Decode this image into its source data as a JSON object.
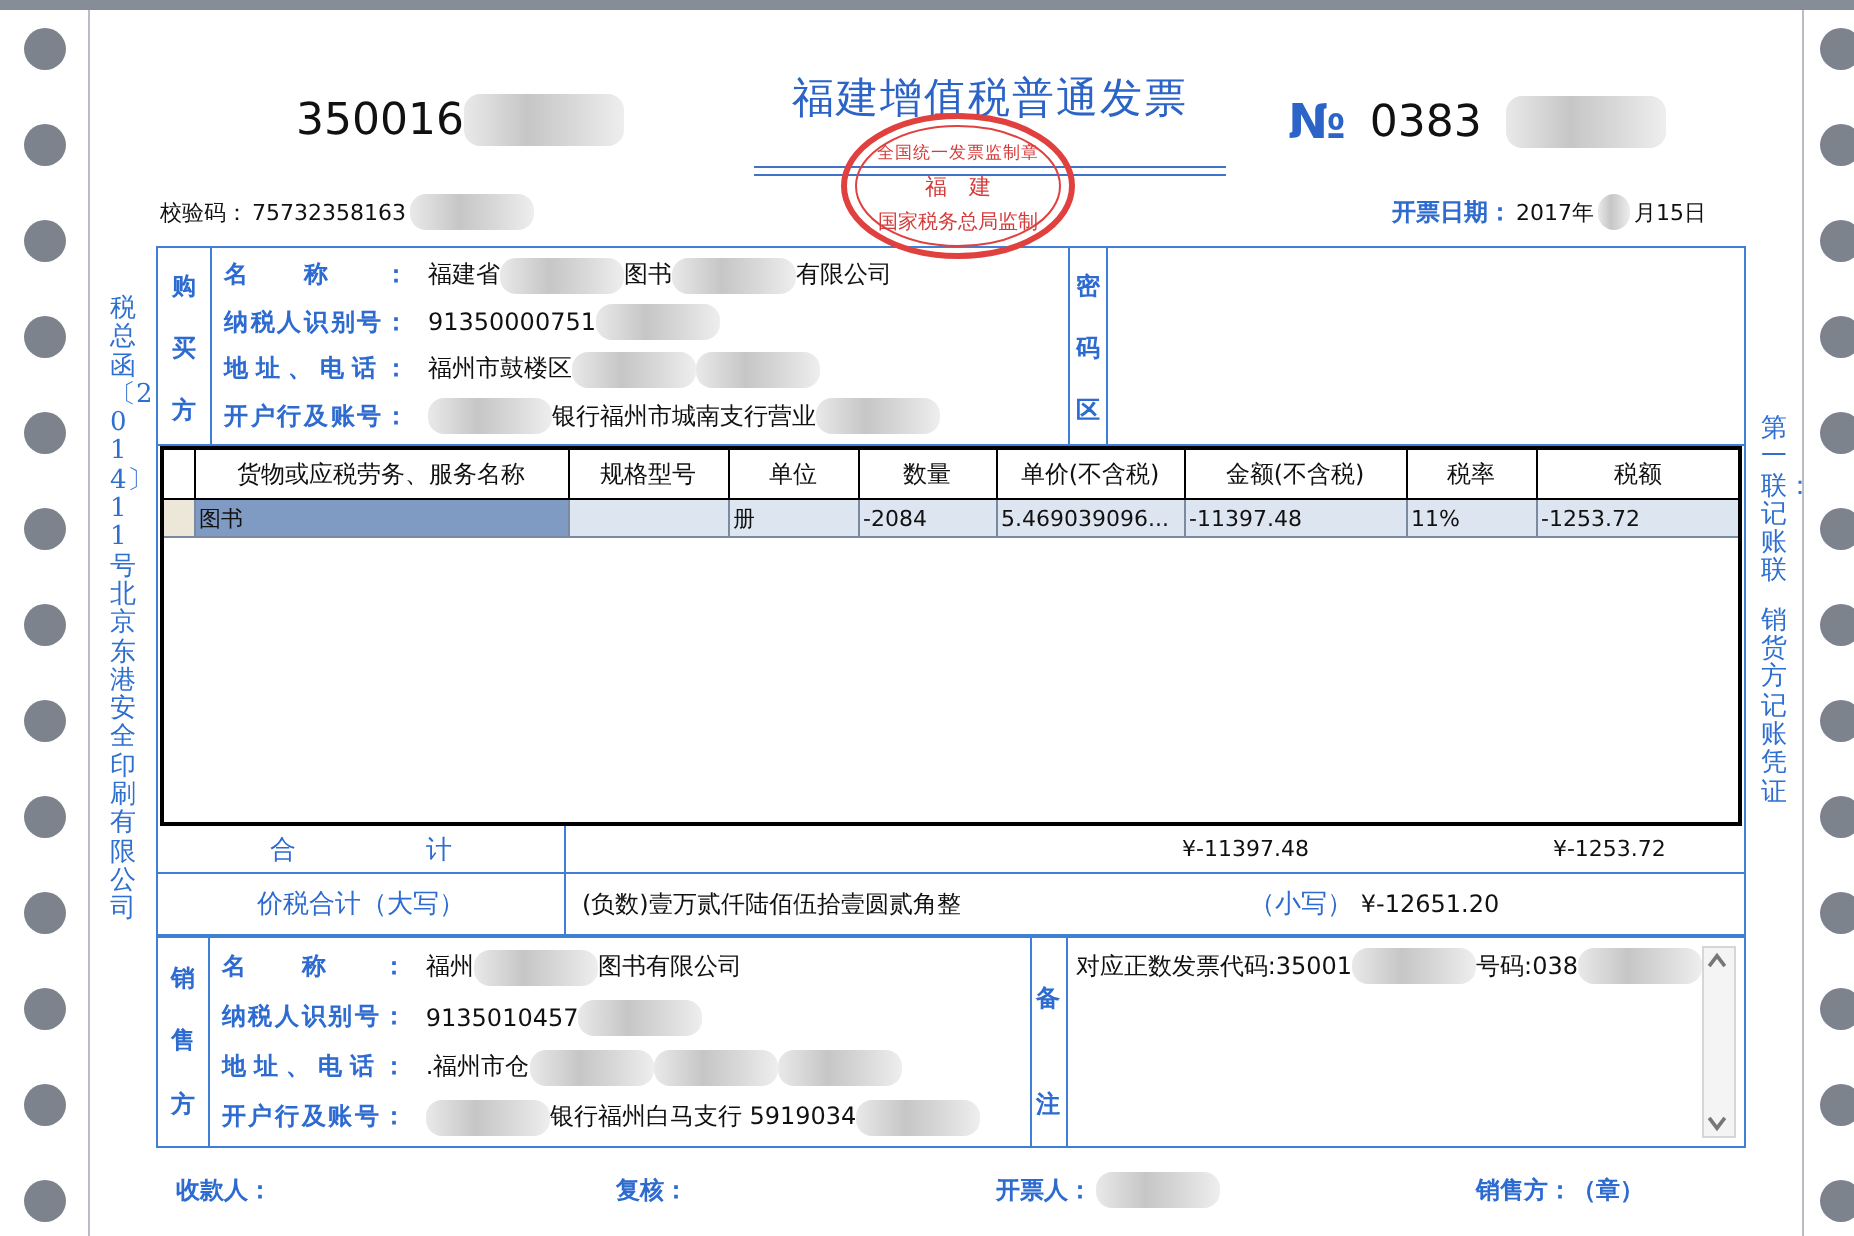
{
  "header": {
    "invoice_code": "350016",
    "title": "福建增值税普通发票",
    "number_sign": "№",
    "invoice_number": "0383",
    "stamp": {
      "top": "全国统一发票监制章",
      "middle": "福　建",
      "bottom": "国家税务总局监制"
    },
    "check_code_label": "校验码：",
    "check_code": "75732358163",
    "date_label": "开票日期：",
    "date_start": "2017年",
    "date_end": "月15日"
  },
  "left_margin_text": "税总函〔2014〕11号北京东港安全印刷有限公司",
  "right_margin_texts": [
    "第一联：记账联",
    "销货方记账凭证"
  ],
  "buyer": {
    "side_label": "购买方",
    "side_label_2": "密码区",
    "fields": [
      {
        "label": "名称：",
        "value": [
          {
            "kind": "text",
            "text": "福建省"
          },
          {
            "kind": "redacted"
          },
          {
            "kind": "text",
            "text": "图书"
          },
          {
            "kind": "redacted"
          },
          {
            "kind": "text",
            "text": "有限公司"
          }
        ]
      },
      {
        "label": "纳税人识别号：",
        "value": [
          {
            "kind": "text",
            "text": "91350000751"
          },
          {
            "kind": "redacted"
          }
        ]
      },
      {
        "label": "地址、电话：",
        "value": [
          {
            "kind": "text",
            "text": "福州市鼓楼区"
          },
          {
            "kind": "redacted"
          },
          {
            "kind": "redacted"
          }
        ]
      },
      {
        "label": "开户行及账号：",
        "value": [
          {
            "kind": "redacted"
          },
          {
            "kind": "text",
            "text": "银行福州市城南支行营业"
          },
          {
            "kind": "redacted"
          }
        ]
      }
    ]
  },
  "items": {
    "columns": [
      "货物或应税劳务、服务名称",
      "规格型号",
      "单位",
      "数量",
      "单价(不含税)",
      "金额(不含税)",
      "税率",
      "税额"
    ],
    "rows": [
      {
        "selected": true,
        "cells": [
          "图书",
          "",
          "册",
          "-2084",
          "5.469039096...",
          "-11397.48",
          "11%",
          "-1253.72"
        ]
      }
    ]
  },
  "totals": {
    "label": "合　　　　　计",
    "amount": "¥-11397.48",
    "tax": "¥-1253.72"
  },
  "grand_total": {
    "label": "价税合计（大写）",
    "words": "(负数)壹万贰仟陆佰伍拾壹圆贰角整",
    "small_label": "（小写）",
    "value": "¥-12651.20"
  },
  "seller": {
    "side_label": "销售方",
    "side_label_2": "备注",
    "fields": [
      {
        "label": "名称：",
        "value": [
          {
            "kind": "text",
            "text": "福州"
          },
          {
            "kind": "redacted"
          },
          {
            "kind": "text",
            "text": "图书有限公司"
          }
        ]
      },
      {
        "label": "纳税人识别号：",
        "value": [
          {
            "kind": "text",
            "text": "9135010457"
          },
          {
            "kind": "redacted"
          }
        ]
      },
      {
        "label": "地址、电话：",
        "value": [
          {
            "kind": "text",
            "text": ".福州市仓"
          },
          {
            "kind": "redacted"
          },
          {
            "kind": "redacted"
          },
          {
            "kind": "redacted"
          }
        ]
      },
      {
        "label": "开户行及账号：",
        "value": [
          {
            "kind": "redacted"
          },
          {
            "kind": "text",
            "text": "银行福州白马支行 5919034"
          },
          {
            "kind": "redacted"
          }
        ]
      }
    ],
    "remark": [
      {
        "kind": "text",
        "text": "对应正数发票代码:35001"
      },
      {
        "kind": "redacted"
      },
      {
        "kind": "text",
        "text": "号码:038"
      },
      {
        "kind": "redacted"
      }
    ]
  },
  "footer": [
    {
      "label": "收款人：",
      "redacted": false
    },
    {
      "label": "复核：",
      "redacted": false
    },
    {
      "label": "开票人：",
      "redacted": true
    },
    {
      "label": "销售方：（章）",
      "redacted": false
    }
  ]
}
